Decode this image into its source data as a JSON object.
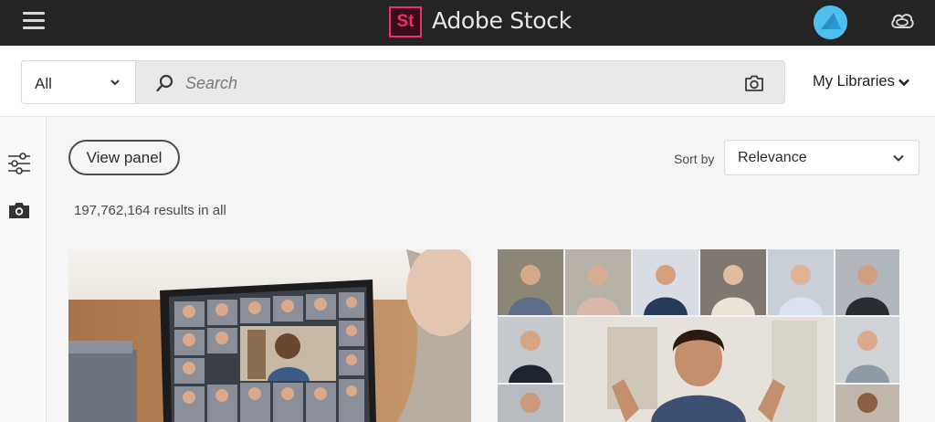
{
  "header": {
    "app_title": "Adobe Stock",
    "logo_text": "St",
    "menu_icon": "hamburger-menu-icon",
    "cloud_icon": "creative-cloud-icon",
    "brand_color": "#ec2f6a",
    "avatar_color": "#4ec0ef"
  },
  "search": {
    "scope_value": "All",
    "placeholder": "Search",
    "value": "",
    "camera_icon": "camera-icon",
    "libraries_label": "My Libraries"
  },
  "toolbar": {
    "view_panel_label": "View panel",
    "sort_label": "Sort by",
    "sort_value": "Relevance"
  },
  "rail": {
    "filter_icon": "filter-sliders-icon",
    "camera_icon": "camera-icon"
  },
  "results": {
    "count_text": "197,762,164 results in all",
    "tiles": [
      {
        "alt": "video-call-laptop-photo"
      },
      {
        "alt": "video-conference-grid-photo"
      }
    ]
  }
}
